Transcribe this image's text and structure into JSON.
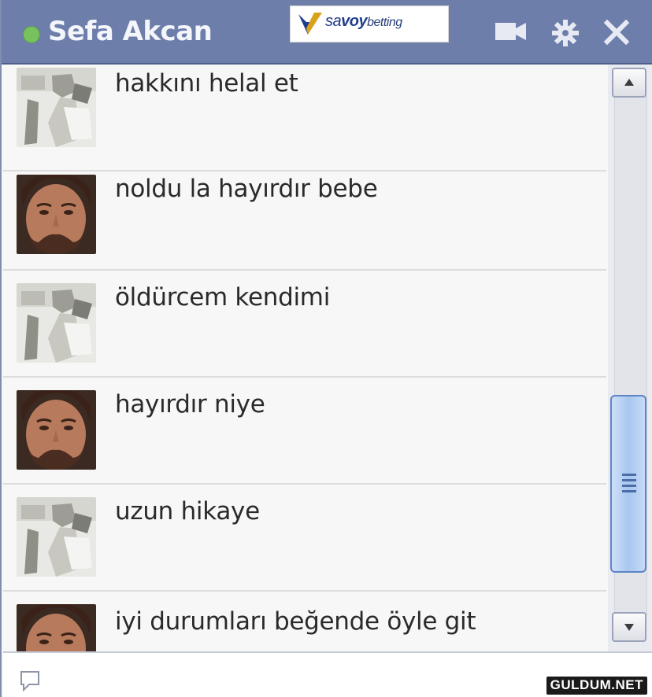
{
  "window": {
    "contact_name": "Sefa Akcan",
    "status": "online",
    "status_color": "#78c25d",
    "header_color": "#6d7eaa"
  },
  "ad": {
    "brand_prefix": "sa",
    "brand_bold": "voy",
    "brand_suffix": "betting"
  },
  "toolbar": {
    "icons": [
      "video-call-icon",
      "gear-icon",
      "close-icon"
    ]
  },
  "messages": [
    {
      "sender": "friend-avatar-1",
      "text": "hakkını helal et"
    },
    {
      "sender": "friend-avatar-2",
      "text": "noldu la hayırdır bebe"
    },
    {
      "sender": "friend-avatar-1",
      "text": "öldürcem kendimi"
    },
    {
      "sender": "friend-avatar-2",
      "text": "hayırdır niye"
    },
    {
      "sender": "friend-avatar-1",
      "text": "uzun hikaye"
    },
    {
      "sender": "friend-avatar-2",
      "text": "iyi durumları beğende öyle git"
    }
  ],
  "composer": {
    "value": "",
    "placeholder": ""
  },
  "watermark": "GULDUM.NET"
}
